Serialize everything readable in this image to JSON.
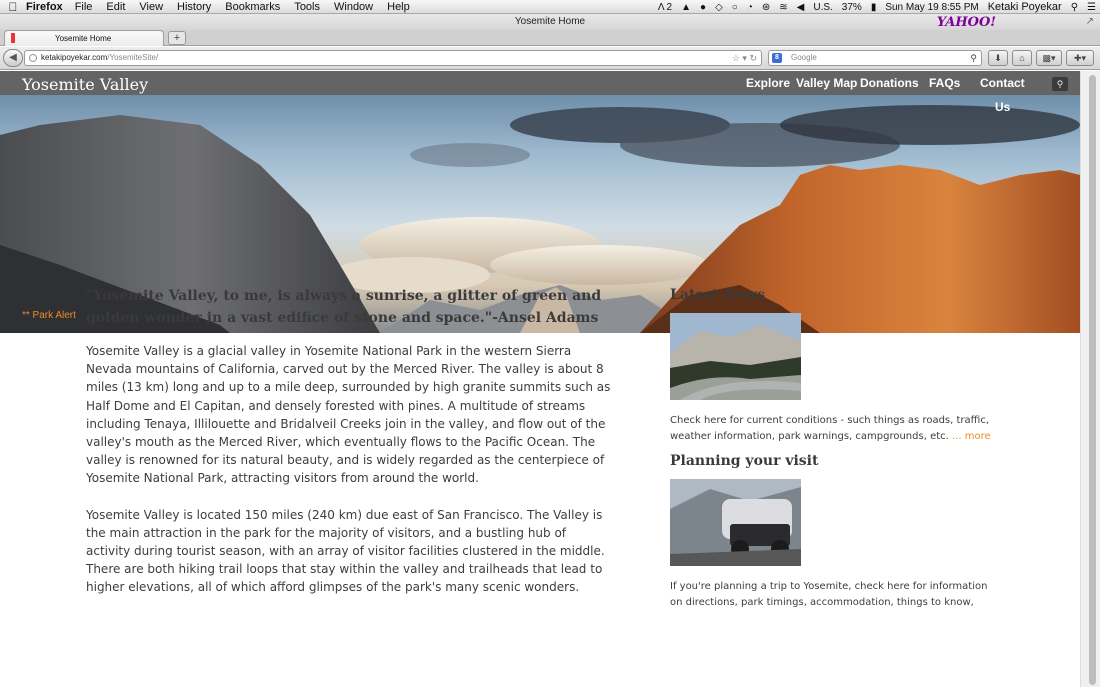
{
  "menubar": {
    "app_name": "Firefox",
    "items": [
      "File",
      "Edit",
      "View",
      "History",
      "Bookmarks",
      "Tools",
      "Window",
      "Help"
    ],
    "status": {
      "adobe_count": "2",
      "input_source": "U.S.",
      "battery": "37%",
      "clock": "Sun May 19  8:55 PM",
      "user": "Ketaki Poyekar"
    }
  },
  "browser": {
    "window_title": "Yosemite Home",
    "yahoo_logo": "YAHOO!",
    "tab_title": "Yosemite Home",
    "new_tab": "+",
    "url_host": "ketakipoyekar.com",
    "url_path": "/YosemiteSite/",
    "search_placeholder": "Google"
  },
  "site": {
    "title": "Yosemite Valley",
    "nav": {
      "explore": "Explore",
      "valley_map": "Valley Map",
      "donations": "Donations",
      "faqs": "FAQs",
      "contact_1": "Contact",
      "contact_2": "Us"
    },
    "park_alert": "** Park Alert",
    "quote": "\"Yosemite Valley, to me, is always a sunrise, a glitter of green and golden wonder in a vast edifice of stone and space.\"-Ansel Adams",
    "paragraphs": [
      "Yosemite Valley is a glacial valley in Yosemite National Park in the western Sierra Nevada mountains of California, carved out by the Merced River. The valley is about 8 miles (13 km) long and up to a mile deep, surrounded by high granite summits such as Half Dome and El Capitan, and densely forested with pines. A multitude of streams including Tenaya, Illilouette and Bridalveil Creeks join in the valley, and flow out of the valley's mouth as the Merced River, which eventually flows to the Pacific Ocean. The valley is renowned for its natural beauty, and is widely regarded as the centerpiece of Yosemite National Park, attracting visitors from around the world.",
      "Yosemite Valley is located 150 miles (240 km) due east of San Francisco. The Valley is the main attraction in the park for the majority of visitors, and a bustling hub of activity during tourist season, with an array of visitor facilities clustered in the middle. There are both hiking trail loops that stay within the valley and trailheads that lead to higher elevations, all of which afford glimpses of the park's many scenic wonders."
    ],
    "sidebar": {
      "news_heading": "Latest News",
      "news_text": "Check here for current conditions - such things as roads, traffic, weather information, park warnings, campgrounds, etc.",
      "news_more": "... more",
      "planning_heading": "Planning your visit",
      "planning_text": "If you're planning a trip to Yosemite, check here for information on directions, park timings, accommodation, things to know,"
    }
  }
}
